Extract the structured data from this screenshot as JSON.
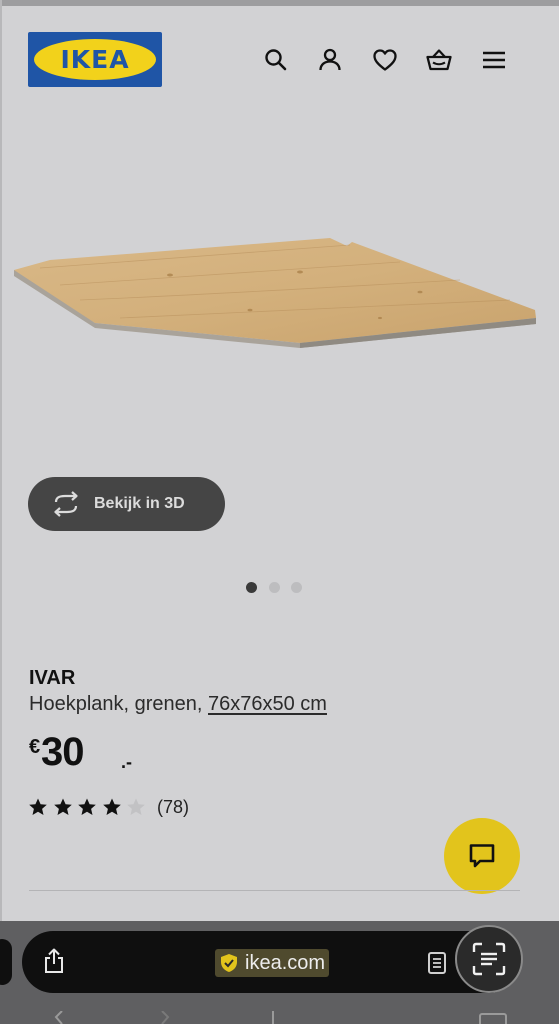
{
  "header": {
    "logo_text": "IKEA",
    "icons": [
      "search-icon",
      "account-icon",
      "heart-icon",
      "cart-icon",
      "menu-icon"
    ]
  },
  "gallery": {
    "view3d_label": "Bekijk in 3D",
    "slide_count": 3,
    "active_slide": 1
  },
  "product": {
    "brand": "IVAR",
    "description": "Hoekplank, grenen, ",
    "dimensions": "76x76x50 cm",
    "price": {
      "currency": "€",
      "integer": "30",
      "decimal": ".-"
    },
    "rating": 4,
    "rating_max": 5,
    "review_count": "(78)"
  },
  "browser": {
    "domain": "ikea.com"
  },
  "colors": {
    "page_bg": "#d2d2d4",
    "logo_blue": "#1f55a6",
    "logo_yellow": "#f2d21b",
    "chat_yellow": "#e2c41c",
    "button_dark": "#454545"
  }
}
